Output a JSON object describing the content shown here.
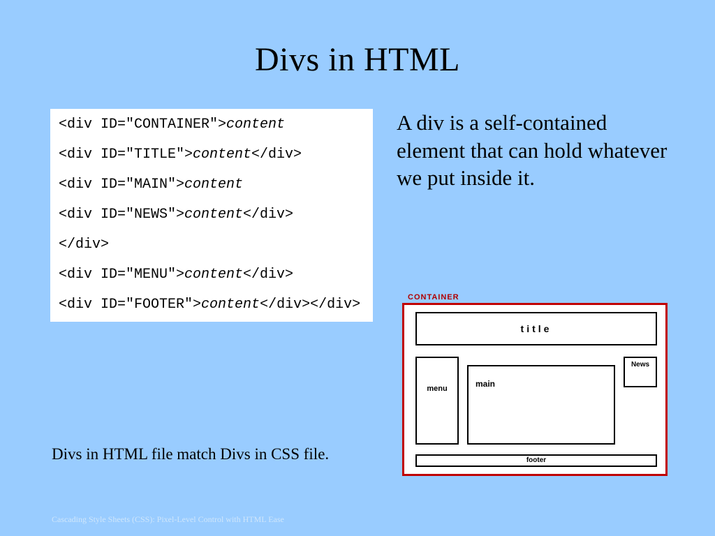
{
  "title": "Divs in HTML",
  "code": {
    "l1_pre": "<div ID=\"CONTAINER\">",
    "l1_em": "content",
    "l2_pre": "<div ID=\"TITLE\">",
    "l2_em": "content",
    "l2_post": "</div>",
    "l3_pre": "<div ID=\"MAIN\">",
    "l3_em": "content",
    "l4_pre": "<div ID=\"NEWS\">",
    "l4_em": "content",
    "l4_post": "</div>",
    "l5": "</div>",
    "l6_pre": "<div ID=\"MENU\">",
    "l6_em": "content",
    "l6_post": "</div>",
    "l7_pre": "<div ID=\"FOOTER\">",
    "l7_em": "content",
    "l7_post": "</div></div>"
  },
  "description": "A div is a self-contained element that can hold whatever we put inside it.",
  "caption": "Divs in HTML file match Divs in CSS file.",
  "footer_note": "Cascading Style Sheets (CSS): Pixel-Level Control with HTML Ease",
  "diagram": {
    "container_label": "CONTAINER",
    "title_label": "title",
    "menu_label": "menu",
    "main_label": "main",
    "news_label": "News",
    "footer_label": "footer"
  }
}
